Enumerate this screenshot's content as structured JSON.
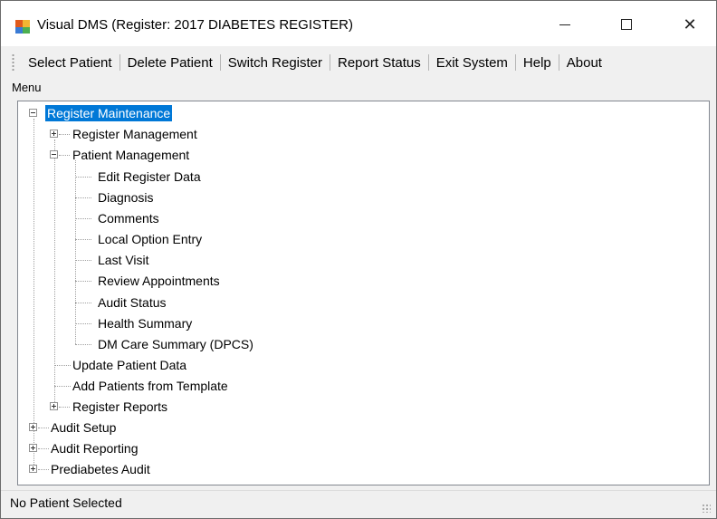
{
  "window": {
    "title": "Visual DMS (Register: 2017 DIABETES REGISTER)"
  },
  "menu": {
    "items": [
      {
        "label": "Select Patient"
      },
      {
        "label": "Delete Patient"
      },
      {
        "label": "Switch Register"
      },
      {
        "label": "Report Status"
      },
      {
        "label": "Exit System"
      },
      {
        "label": "Help"
      },
      {
        "label": "About"
      }
    ],
    "caption": "Menu"
  },
  "tree": {
    "register_maintenance": "Register Maintenance",
    "register_management": "Register Management",
    "patient_management": "Patient Management",
    "edit_register_data": "Edit Register Data",
    "diagnosis": "Diagnosis",
    "comments": "Comments",
    "local_option_entry": "Local Option Entry",
    "last_visit": "Last Visit",
    "review_appointments": "Review Appointments",
    "audit_status": "Audit Status",
    "health_summary": "Health Summary",
    "dm_care_summary": "DM Care Summary (DPCS)",
    "update_patient_data": "Update Patient Data",
    "add_patients_from_template": "Add Patients from Template",
    "register_reports": "Register Reports",
    "audit_setup": "Audit Setup",
    "audit_reporting": "Audit Reporting",
    "prediabetes_audit": "Prediabetes Audit"
  },
  "status": {
    "text": "No Patient Selected"
  }
}
